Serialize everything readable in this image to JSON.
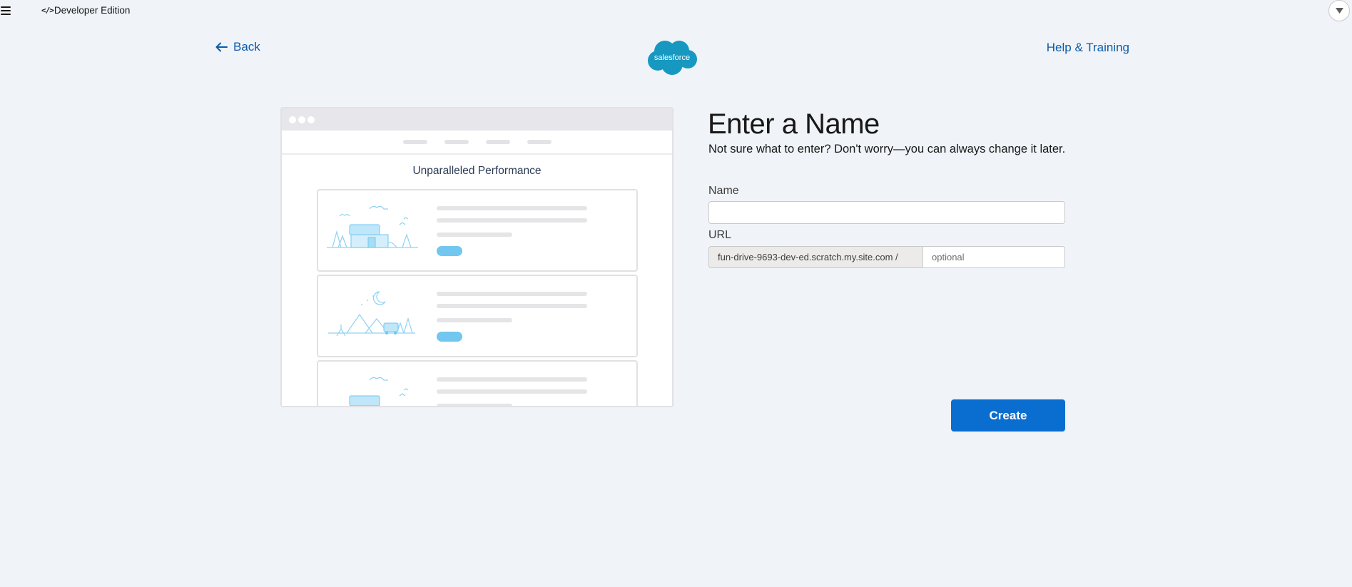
{
  "topbar": {
    "edition_label": "Developer Edition",
    "code_glyph": "</>"
  },
  "header": {
    "back_label": "Back",
    "help_label": "Help & Training",
    "logo_text": "salesforce"
  },
  "preview": {
    "title": "Unparalleled Performance"
  },
  "form": {
    "title": "Enter a Name",
    "subtitle": "Not sure what to enter? Don't worry—you can always change it later.",
    "name_label": "Name",
    "name_value": "",
    "url_label": "URL",
    "url_prefix": "fun-drive-9693-dev-ed.scratch.my.site.com /",
    "url_placeholder": "optional",
    "create_label": "Create"
  },
  "colors": {
    "background": "#f0f3f7",
    "link": "#0b5cab",
    "brand": "#0a6ed1",
    "logo_cloud": "#1798c1",
    "illustration_accent": "#71c7f0"
  }
}
